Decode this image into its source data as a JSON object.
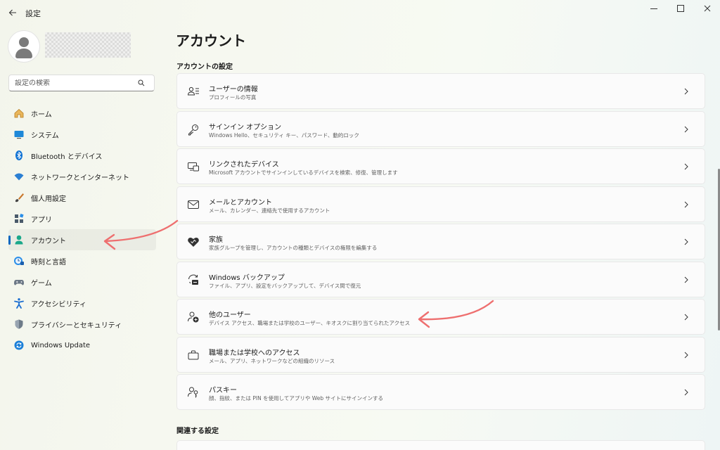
{
  "window": {
    "title": "設定"
  },
  "sidebar": {
    "search_placeholder": "設定の検索",
    "items": [
      {
        "label": "ホーム",
        "icon": "home-icon",
        "active": false
      },
      {
        "label": "システム",
        "icon": "system-icon",
        "active": false
      },
      {
        "label": "Bluetooth とデバイス",
        "icon": "bluetooth-icon",
        "active": false
      },
      {
        "label": "ネットワークとインターネット",
        "icon": "wifi-icon",
        "active": false
      },
      {
        "label": "個人用設定",
        "icon": "brush-icon",
        "active": false
      },
      {
        "label": "アプリ",
        "icon": "apps-icon",
        "active": false
      },
      {
        "label": "アカウント",
        "icon": "account-icon",
        "active": true
      },
      {
        "label": "時刻と言語",
        "icon": "time-language-icon",
        "active": false
      },
      {
        "label": "ゲーム",
        "icon": "gamepad-icon",
        "active": false
      },
      {
        "label": "アクセシビリティ",
        "icon": "accessibility-icon",
        "active": false
      },
      {
        "label": "プライバシーとセキュリティ",
        "icon": "shield-icon",
        "active": false
      },
      {
        "label": "Windows Update",
        "icon": "update-icon",
        "active": false
      }
    ]
  },
  "main": {
    "title": "アカウント",
    "section_account_settings": "アカウントの設定",
    "section_related": "関連する設定",
    "cards": [
      {
        "title": "ユーザーの情報",
        "desc": "プロフィールの写真",
        "icon": "user-info-icon"
      },
      {
        "title": "サインイン オプション",
        "desc": "Windows Hello、セキュリティ キー、パスワード、動的ロック",
        "icon": "key-icon"
      },
      {
        "title": "リンクされたデバイス",
        "desc": "Microsoft アカウントでサインインしているデバイスを検索、修復、管理します",
        "icon": "linked-devices-icon"
      },
      {
        "title": "メールとアカウント",
        "desc": "メール、カレンダー、連絡先で使用するアカウント",
        "icon": "mail-icon"
      },
      {
        "title": "家族",
        "desc": "家族グループを管理し、アカウントの種類とデバイスの権限を編集する",
        "icon": "family-heart-icon"
      },
      {
        "title": "Windows バックアップ",
        "desc": "ファイル、アプリ、設定をバックアップして、デバイス間で復元",
        "icon": "backup-icon"
      },
      {
        "title": "他のユーザー",
        "desc": "デバイス アクセス、職場または学校のユーザー、キオスクに割り当てられたアクセス",
        "icon": "add-user-icon"
      },
      {
        "title": "職場または学校へのアクセス",
        "desc": "メール、アプリ、ネットワークなどの組織のリソース",
        "icon": "briefcase-icon"
      },
      {
        "title": "パスキー",
        "desc": "顔、指紋、または PIN を使用してアプリや Web サイトにサインインする",
        "icon": "passkey-icon"
      }
    ]
  },
  "colors": {
    "accent": "#0067c0",
    "annotation_arrow": "#ee6f6f"
  }
}
